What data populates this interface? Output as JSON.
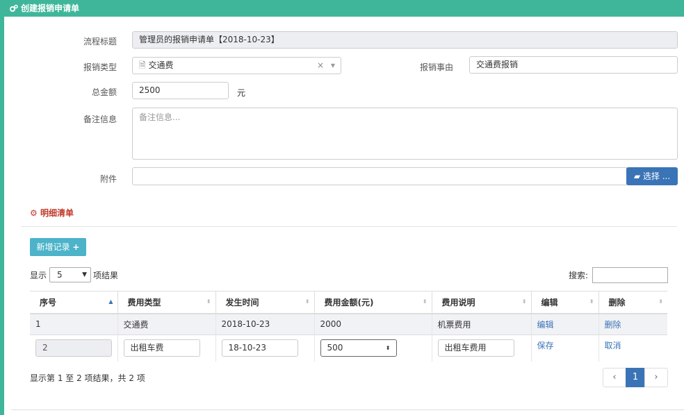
{
  "header": {
    "title": "创建报销申请单"
  },
  "form": {
    "title_label": "流程标题",
    "title_value": "管理员的报销申请单【2018-10-23】",
    "type_label": "报销类型",
    "type_value": "交通费",
    "reason_label": "报销事由",
    "reason_value": "交通费报销",
    "amount_label": "总金额",
    "amount_value": "2500",
    "amount_unit": "元",
    "note_label": "备注信息",
    "note_placeholder": "备注信息...",
    "attach_label": "附件",
    "select_button": "选择 ..."
  },
  "detail": {
    "section_title": "明细清单",
    "add_button": "新增记录",
    "show_label": "显示",
    "page_length": "5",
    "results_label": "项结果",
    "search_label": "搜索:",
    "columns": [
      "序号",
      "费用类型",
      "发生时间",
      "费用金额(元)",
      "费用说明",
      "编辑",
      "删除"
    ],
    "row1": {
      "no": "1",
      "type": "交通费",
      "date": "2018-10-23",
      "amount": "2000",
      "desc": "机票费用",
      "edit": "编辑",
      "delete": "删除"
    },
    "row2": {
      "no": "2",
      "type": "出租车费",
      "date": "18-10-23",
      "amount": "500",
      "desc": "出租车费用",
      "save": "保存",
      "cancel": "取消"
    },
    "info": "显示第 1 至 2 项结果，共 2 项",
    "pager": {
      "prev": "‹",
      "current": "1",
      "next": "›"
    }
  }
}
